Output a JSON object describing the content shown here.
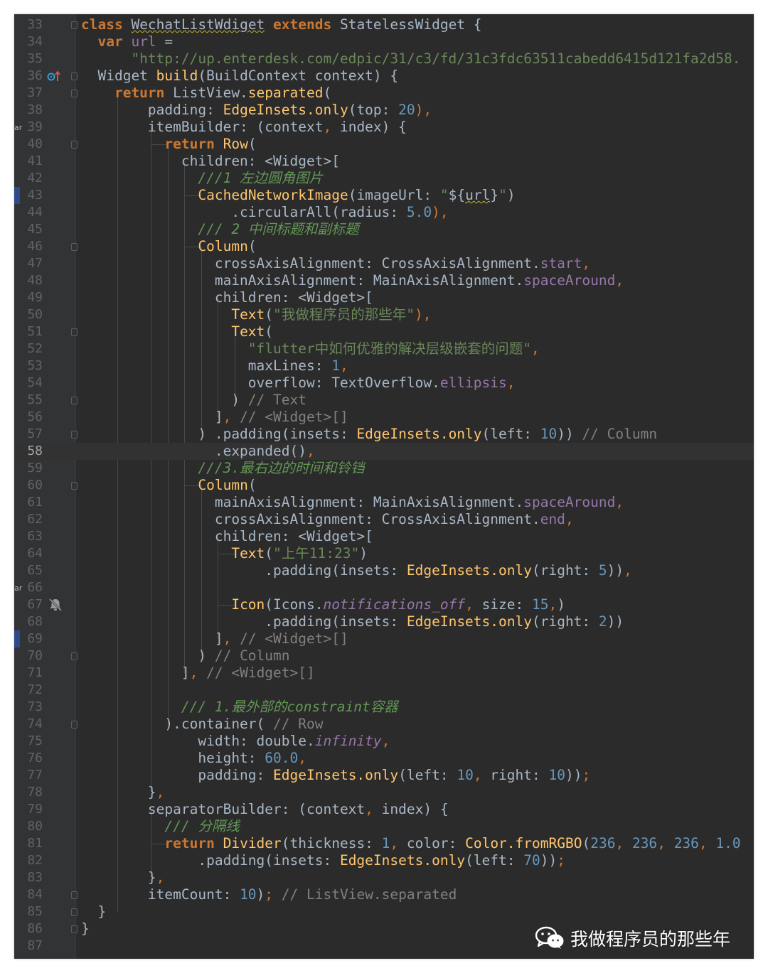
{
  "editor": {
    "current_line": 58,
    "lines": [
      {
        "n": 33,
        "t": [
          [
            "class ",
            "kw"
          ],
          [
            "WechatListWdiget",
            "cls squig"
          ],
          [
            " extends ",
            "kw"
          ],
          [
            "StatelessWidget {",
            "cls"
          ]
        ]
      },
      {
        "n": 34,
        "t": [
          [
            "  var ",
            "kw"
          ],
          [
            "url",
            "field"
          ],
          [
            " =",
            "cls"
          ]
        ]
      },
      {
        "n": 35,
        "t": [
          [
            "      \"http://up.enterdesk.com/edpic/31/c3/fd/31c3fdc63511cabedd6415d121fa2d58.",
            "str"
          ]
        ]
      },
      {
        "n": 36,
        "t": [
          [
            "  Widget ",
            "cls"
          ],
          [
            "build",
            "fn"
          ],
          [
            "(BuildContext context) {",
            "cls"
          ]
        ]
      },
      {
        "n": 37,
        "t": [
          [
            "    return ",
            "kw"
          ],
          [
            "ListView.",
            "cls"
          ],
          [
            "separated",
            "fn"
          ],
          [
            "(",
            "cls"
          ]
        ]
      },
      {
        "n": 38,
        "t": [
          [
            "        padding: ",
            "cls"
          ],
          [
            "EdgeInsets.",
            "fn"
          ],
          [
            "only",
            "fn"
          ],
          [
            "(top: ",
            "cls"
          ],
          [
            "20",
            "num"
          ],
          [
            "),",
            "punct"
          ]
        ]
      },
      {
        "n": 39,
        "t": [
          [
            "        itemBuilder: (context",
            "cls"
          ],
          [
            ",",
            "punct"
          ],
          [
            " index) {",
            "cls"
          ]
        ]
      },
      {
        "n": 40,
        "t": [
          [
            "          return ",
            "kw"
          ],
          [
            "Row",
            "fn"
          ],
          [
            "(",
            "cls"
          ]
        ]
      },
      {
        "n": 41,
        "t": [
          [
            "            children: <Widget>[",
            "cls"
          ]
        ]
      },
      {
        "n": 42,
        "t": [
          [
            "              ///1 左边圆角图片",
            "doc"
          ]
        ]
      },
      {
        "n": 43,
        "t": [
          [
            "              ",
            "cls"
          ],
          [
            "CachedNetworkImage",
            "fn"
          ],
          [
            "(imageUrl: ",
            "cls"
          ],
          [
            "\"",
            "str"
          ],
          [
            "${",
            "cls"
          ],
          [
            "url",
            "cls squig"
          ],
          [
            "}",
            "cls"
          ],
          [
            "\"",
            "str"
          ],
          [
            ")",
            "cls"
          ]
        ]
      },
      {
        "n": 44,
        "t": [
          [
            "                  .circularAll(radius: ",
            "cls"
          ],
          [
            "5.0",
            "num"
          ],
          [
            "),",
            "punct"
          ]
        ]
      },
      {
        "n": 45,
        "t": [
          [
            "              /// 2 中间标题和副标题",
            "doc"
          ]
        ]
      },
      {
        "n": 46,
        "t": [
          [
            "              ",
            "cls"
          ],
          [
            "Column",
            "fn"
          ],
          [
            "(",
            "cls"
          ]
        ]
      },
      {
        "n": 47,
        "t": [
          [
            "                crossAxisAlignment: CrossAxisAlignment.",
            "cls"
          ],
          [
            "start",
            "field"
          ],
          [
            ",",
            "punct"
          ]
        ]
      },
      {
        "n": 48,
        "t": [
          [
            "                mainAxisAlignment: MainAxisAlignment.",
            "cls"
          ],
          [
            "spaceAround",
            "field"
          ],
          [
            ",",
            "punct"
          ]
        ]
      },
      {
        "n": 49,
        "t": [
          [
            "                children: <Widget>[",
            "cls"
          ]
        ]
      },
      {
        "n": 50,
        "t": [
          [
            "                  ",
            "cls"
          ],
          [
            "Text",
            "fn"
          ],
          [
            "(",
            "cls"
          ],
          [
            "\"我做程序员的那些年\"",
            "str"
          ],
          [
            "),",
            "punct"
          ]
        ]
      },
      {
        "n": 51,
        "t": [
          [
            "                  ",
            "cls"
          ],
          [
            "Text",
            "fn"
          ],
          [
            "(",
            "cls"
          ]
        ]
      },
      {
        "n": 52,
        "t": [
          [
            "                    \"flutter中如何优雅的解决层级嵌套的问题\"",
            "str"
          ],
          [
            ",",
            "punct"
          ]
        ]
      },
      {
        "n": 53,
        "t": [
          [
            "                    maxLines: ",
            "cls"
          ],
          [
            "1",
            "num"
          ],
          [
            ",",
            "punct"
          ]
        ]
      },
      {
        "n": 54,
        "t": [
          [
            "                    overflow: TextOverflow.",
            "cls"
          ],
          [
            "ellipsis",
            "field"
          ],
          [
            ",",
            "punct"
          ]
        ]
      },
      {
        "n": 55,
        "t": [
          [
            "                  ) ",
            "cls"
          ],
          [
            "// Text",
            "cm"
          ]
        ]
      },
      {
        "n": 56,
        "t": [
          [
            "                ]",
            "cls"
          ],
          [
            ",",
            "punct"
          ],
          [
            " ",
            "cls"
          ],
          [
            "// <Widget>[]",
            "cm"
          ]
        ]
      },
      {
        "n": 57,
        "t": [
          [
            "              ) .padding(insets: ",
            "cls"
          ],
          [
            "EdgeInsets.",
            "fn"
          ],
          [
            "only",
            "fn"
          ],
          [
            "(left: ",
            "cls"
          ],
          [
            "10",
            "num"
          ],
          [
            ")) ",
            "cls"
          ],
          [
            "// Column",
            "cm"
          ]
        ]
      },
      {
        "n": 58,
        "t": [
          [
            "                .expanded()",
            "cls"
          ],
          [
            ",",
            "punct"
          ]
        ]
      },
      {
        "n": 59,
        "t": [
          [
            "              ///3.最右边的时间和铃铛",
            "doc"
          ]
        ]
      },
      {
        "n": 60,
        "t": [
          [
            "              ",
            "cls"
          ],
          [
            "Column",
            "fn"
          ],
          [
            "(",
            "cls"
          ]
        ]
      },
      {
        "n": 61,
        "t": [
          [
            "                mainAxisAlignment: MainAxisAlignment.",
            "cls"
          ],
          [
            "spaceAround",
            "field"
          ],
          [
            ",",
            "punct"
          ]
        ]
      },
      {
        "n": 62,
        "t": [
          [
            "                crossAxisAlignment: CrossAxisAlignment.",
            "cls"
          ],
          [
            "end",
            "field"
          ],
          [
            ",",
            "punct"
          ]
        ]
      },
      {
        "n": 63,
        "t": [
          [
            "                children: <Widget>[",
            "cls"
          ]
        ]
      },
      {
        "n": 64,
        "t": [
          [
            "                  ",
            "cls"
          ],
          [
            "Text",
            "fn"
          ],
          [
            "(",
            "cls"
          ],
          [
            "\"上午11:23\"",
            "str"
          ],
          [
            ")",
            "cls"
          ]
        ]
      },
      {
        "n": 65,
        "t": [
          [
            "                      .padding(insets: ",
            "cls"
          ],
          [
            "EdgeInsets.",
            "fn"
          ],
          [
            "only",
            "fn"
          ],
          [
            "(right: ",
            "cls"
          ],
          [
            "5",
            "num"
          ],
          [
            "))",
            "cls"
          ],
          [
            ",",
            "punct"
          ]
        ]
      },
      {
        "n": 66,
        "t": []
      },
      {
        "n": 67,
        "t": [
          [
            "                  ",
            "cls"
          ],
          [
            "Icon",
            "fn"
          ],
          [
            "(Icons.",
            "cls"
          ],
          [
            "notifications_off",
            "static"
          ],
          [
            ",",
            "punct"
          ],
          [
            " size: ",
            "cls"
          ],
          [
            "15",
            "num"
          ],
          [
            ",",
            "punct"
          ],
          [
            ")",
            "cls"
          ]
        ]
      },
      {
        "n": 68,
        "t": [
          [
            "                      .padding(insets: ",
            "cls"
          ],
          [
            "EdgeInsets.",
            "fn"
          ],
          [
            "only",
            "fn"
          ],
          [
            "(right: ",
            "cls"
          ],
          [
            "2",
            "num"
          ],
          [
            "))",
            "cls"
          ]
        ]
      },
      {
        "n": 69,
        "t": [
          [
            "                ]",
            "cls"
          ],
          [
            ",",
            "punct"
          ],
          [
            " ",
            "cls"
          ],
          [
            "// <Widget>[]",
            "cm"
          ]
        ]
      },
      {
        "n": 70,
        "t": [
          [
            "              ) ",
            "cls"
          ],
          [
            "// Column",
            "cm"
          ]
        ]
      },
      {
        "n": 71,
        "t": [
          [
            "            ]",
            "cls"
          ],
          [
            ",",
            "punct"
          ],
          [
            " ",
            "cls"
          ],
          [
            "// <Widget>[]",
            "cm"
          ]
        ]
      },
      {
        "n": 72,
        "t": []
      },
      {
        "n": 73,
        "t": [
          [
            "            /// 1.最外部的constraint容器",
            "doc"
          ]
        ]
      },
      {
        "n": 74,
        "t": [
          [
            "          ).container( ",
            "cls"
          ],
          [
            "// Row",
            "cm"
          ]
        ]
      },
      {
        "n": 75,
        "t": [
          [
            "              width: double.",
            "cls"
          ],
          [
            "infinity",
            "static"
          ],
          [
            ",",
            "punct"
          ]
        ]
      },
      {
        "n": 76,
        "t": [
          [
            "              height: ",
            "cls"
          ],
          [
            "60.0",
            "num"
          ],
          [
            ",",
            "punct"
          ]
        ]
      },
      {
        "n": 77,
        "t": [
          [
            "              padding: ",
            "cls"
          ],
          [
            "EdgeInsets.",
            "fn"
          ],
          [
            "only",
            "fn"
          ],
          [
            "(left: ",
            "cls"
          ],
          [
            "10",
            "num"
          ],
          [
            ",",
            "punct"
          ],
          [
            " right: ",
            "cls"
          ],
          [
            "10",
            "num"
          ],
          [
            "))",
            "cls"
          ],
          [
            ";",
            "punct"
          ]
        ]
      },
      {
        "n": 78,
        "t": [
          [
            "        }",
            "cls"
          ],
          [
            ",",
            "punct"
          ]
        ]
      },
      {
        "n": 79,
        "t": [
          [
            "        separatorBuilder: (context",
            "cls"
          ],
          [
            ",",
            "punct"
          ],
          [
            " index) {",
            "cls"
          ]
        ]
      },
      {
        "n": 80,
        "t": [
          [
            "          /// 分隔线",
            "doc"
          ]
        ]
      },
      {
        "n": 81,
        "t": [
          [
            "          return ",
            "kw"
          ],
          [
            "Divider",
            "fn"
          ],
          [
            "(thickness: ",
            "cls"
          ],
          [
            "1",
            "num"
          ],
          [
            ",",
            "punct"
          ],
          [
            " color: ",
            "cls"
          ],
          [
            "Color.",
            "fn"
          ],
          [
            "fromRGBO",
            "fn"
          ],
          [
            "(",
            "cls"
          ],
          [
            "236",
            "num"
          ],
          [
            ",",
            "punct"
          ],
          [
            " ",
            "cls"
          ],
          [
            "236",
            "num"
          ],
          [
            ",",
            "punct"
          ],
          [
            " ",
            "cls"
          ],
          [
            "236",
            "num"
          ],
          [
            ",",
            "punct"
          ],
          [
            " ",
            "cls"
          ],
          [
            "1.0",
            "num"
          ]
        ]
      },
      {
        "n": 82,
        "t": [
          [
            "              .padding(insets: ",
            "cls"
          ],
          [
            "EdgeInsets.",
            "fn"
          ],
          [
            "only",
            "fn"
          ],
          [
            "(left: ",
            "cls"
          ],
          [
            "70",
            "num"
          ],
          [
            "))",
            "cls"
          ],
          [
            ";",
            "punct"
          ]
        ]
      },
      {
        "n": 83,
        "t": [
          [
            "        }",
            "cls"
          ],
          [
            ",",
            "punct"
          ]
        ]
      },
      {
        "n": 84,
        "t": [
          [
            "        itemCount: ",
            "cls"
          ],
          [
            "10",
            "num"
          ],
          [
            ")",
            "cls"
          ],
          [
            ";",
            "punct"
          ],
          [
            " ",
            "cls"
          ],
          [
            "// ListView.separated",
            "cm"
          ]
        ]
      },
      {
        "n": 85,
        "t": [
          [
            "  }",
            "cls"
          ]
        ]
      },
      {
        "n": 86,
        "t": [
          [
            "}",
            "cls"
          ]
        ]
      },
      {
        "n": 87,
        "t": []
      }
    ]
  },
  "gutter_markers": {
    "override_line": 36,
    "bell_line": 67,
    "side_label": "ar"
  },
  "watermark": {
    "text": "我做程序员的那些年",
    "icon": "wechat-icon"
  },
  "colors": {
    "background": "#2b2b2b",
    "keyword": "#cc7832",
    "string": "#6a8759",
    "number": "#6897bb",
    "function": "#ffc66d",
    "field": "#9876aa",
    "doc_comment": "#629755",
    "comment": "#808080"
  }
}
